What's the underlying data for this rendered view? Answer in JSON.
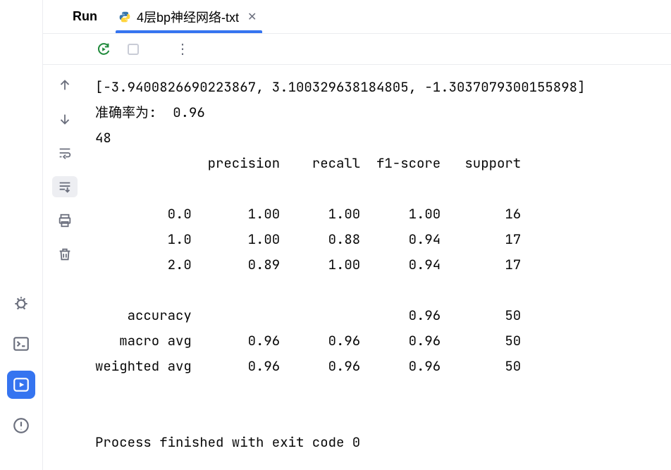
{
  "run_label": "Run",
  "tab": {
    "title": "4层bp神经网络-txt"
  },
  "console_lines": {
    "l0": "[-3.9400826690223867, 3.100329638184805, -1.3037079300155898]",
    "l1": "准确率为:  0.96",
    "l2": "48",
    "l3": "              precision    recall  f1-score   support",
    "l4": "",
    "l5": "         0.0       1.00      1.00      1.00        16",
    "l6": "         1.0       1.00      0.88      0.94        17",
    "l7": "         2.0       0.89      1.00      0.94        17",
    "l8": "",
    "l9": "    accuracy                           0.96        50",
    "l10": "   macro avg       0.96      0.96      0.96        50",
    "l11": "weighted avg       0.96      0.96      0.96        50",
    "l12": "",
    "l13": "",
    "l14": "Process finished with exit code 0"
  },
  "classification_report": {
    "metrics": [
      "precision",
      "recall",
      "f1-score",
      "support"
    ],
    "classes": [
      {
        "label": "0.0",
        "precision": 1.0,
        "recall": 1.0,
        "f1_score": 1.0,
        "support": 16
      },
      {
        "label": "1.0",
        "precision": 1.0,
        "recall": 0.88,
        "f1_score": 0.94,
        "support": 17
      },
      {
        "label": "2.0",
        "precision": 0.89,
        "recall": 1.0,
        "f1_score": 0.94,
        "support": 17
      }
    ],
    "accuracy": {
      "value": 0.96,
      "support": 50
    },
    "macro_avg": {
      "precision": 0.96,
      "recall": 0.96,
      "f1_score": 0.96,
      "support": 50
    },
    "weighted_avg": {
      "precision": 0.96,
      "recall": 0.96,
      "f1_score": 0.96,
      "support": 50
    }
  },
  "accuracy_line_label": "准确率为:",
  "accuracy_value": 0.96,
  "count_value": 48,
  "vector_output": [
    -3.9400826690223867,
    3.100329638184805,
    -1.3037079300155898
  ],
  "exit_message": "Process finished with exit code 0"
}
